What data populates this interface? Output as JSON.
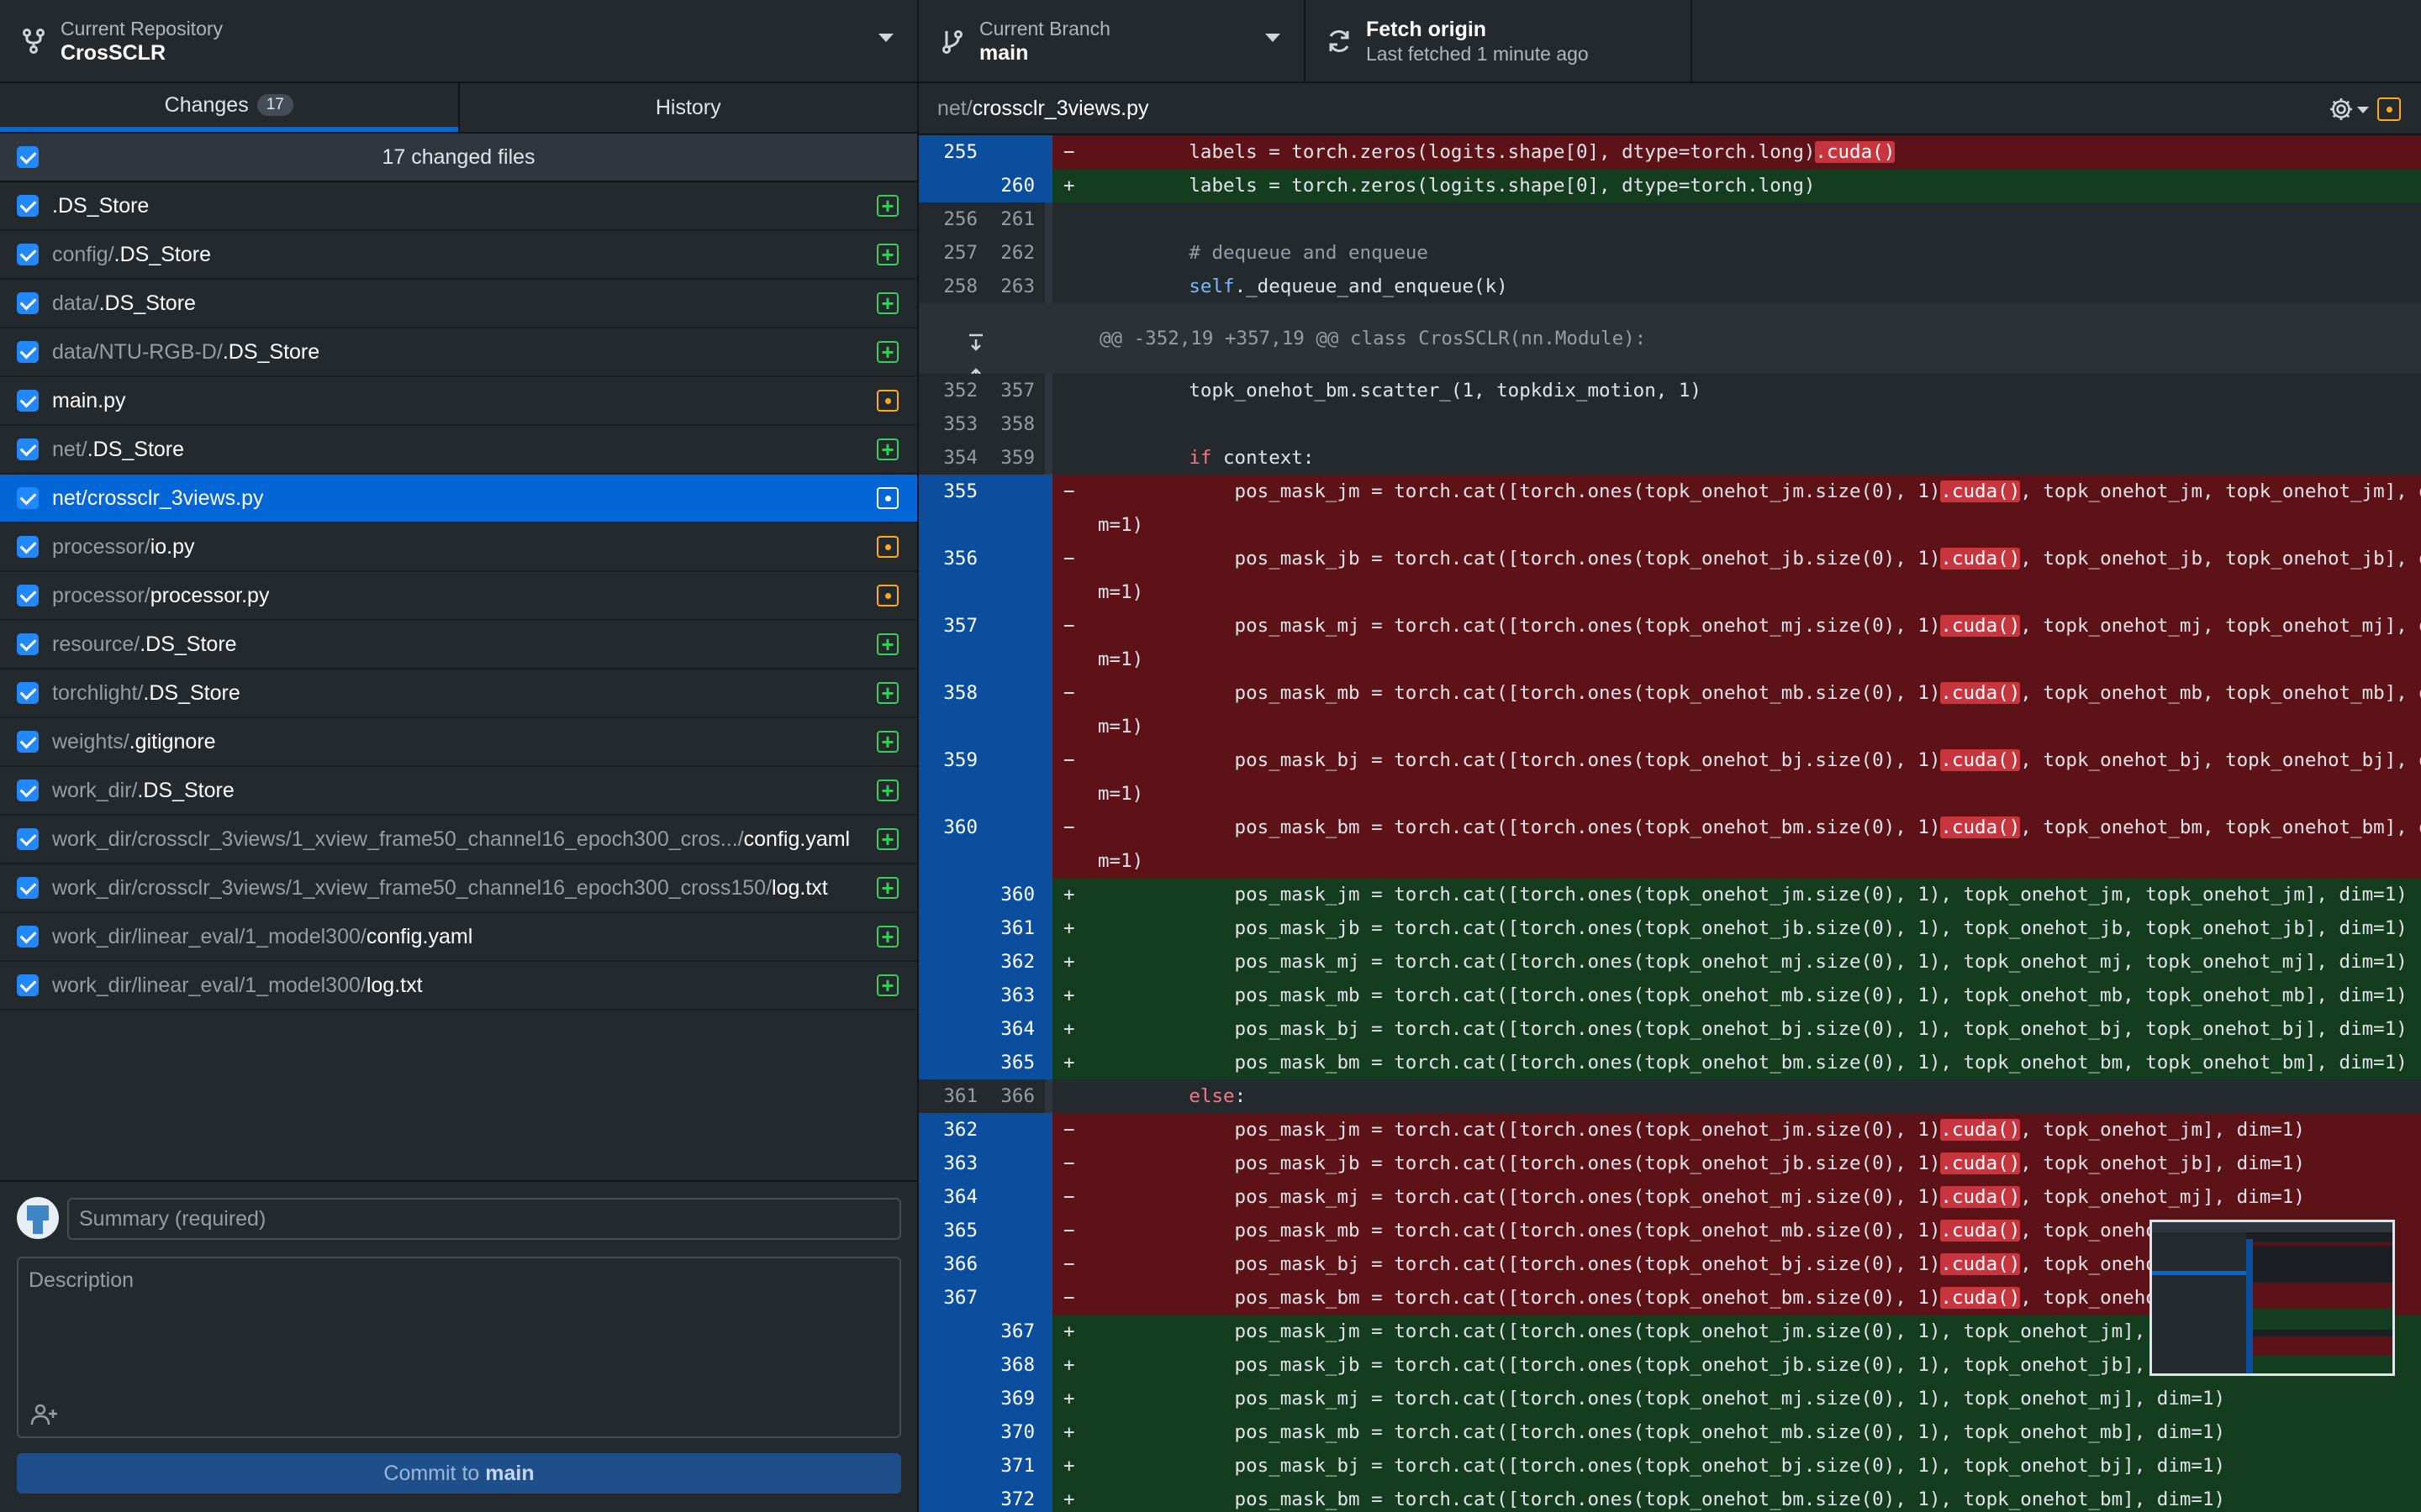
{
  "toolbar": {
    "repo_label": "Current Repository",
    "repo_name": "CrosSCLR",
    "branch_label": "Current Branch",
    "branch_name": "main",
    "fetch_title": "Fetch origin",
    "fetch_sub": "Last fetched 1 minute ago"
  },
  "tabs": {
    "changes_label": "Changes",
    "changes_count": "17",
    "history_label": "History"
  },
  "files_header": "17 changed files",
  "files": [
    {
      "dir": "",
      "name": ".DS_Store",
      "status": "new"
    },
    {
      "dir": "config/",
      "name": ".DS_Store",
      "status": "new"
    },
    {
      "dir": "data/",
      "name": ".DS_Store",
      "status": "new"
    },
    {
      "dir": "data/NTU-RGB-D/",
      "name": ".DS_Store",
      "status": "new"
    },
    {
      "dir": "",
      "name": "main.py",
      "status": "modified"
    },
    {
      "dir": "net/",
      "name": ".DS_Store",
      "status": "new"
    },
    {
      "dir": "net/",
      "name": "crossclr_3views.py",
      "status": "modified",
      "selected": true
    },
    {
      "dir": "processor/",
      "name": "io.py",
      "status": "modified"
    },
    {
      "dir": "processor/",
      "name": "processor.py",
      "status": "modified"
    },
    {
      "dir": "resource/",
      "name": ".DS_Store",
      "status": "new"
    },
    {
      "dir": "torchlight/",
      "name": ".DS_Store",
      "status": "new"
    },
    {
      "dir": "weights/",
      "name": ".gitignore",
      "status": "new"
    },
    {
      "dir": "work_dir/",
      "name": ".DS_Store",
      "status": "new"
    },
    {
      "dir": "work_dir/crossclr_3views/1_xview_frame50_channel16_epoch300_cros.../",
      "name": "config.yaml",
      "status": "new"
    },
    {
      "dir": "work_dir/crossclr_3views/1_xview_frame50_channel16_epoch300_cross150/",
      "name": "log.txt",
      "status": "new"
    },
    {
      "dir": "work_dir/linear_eval/1_model300/",
      "name": "config.yaml",
      "status": "new"
    },
    {
      "dir": "work_dir/linear_eval/1_model300/",
      "name": "log.txt",
      "status": "new"
    }
  ],
  "commit": {
    "summary_placeholder": "Summary (required)",
    "description_placeholder": "Description",
    "button_prefix": "Commit to ",
    "button_branch": "main"
  },
  "diff": {
    "file_dir": "net/",
    "file_name": "crossclr_3views.py",
    "hunk_header": "@@ -352,19 +357,19 @@ class CrosSCLR(nn.Module):",
    "lines": [
      {
        "type": "del",
        "old": "255",
        "new": "",
        "segs": [
          [
            "",
            "        labels = torch.zeros(logits.shape[0], dtype=torch.long)"
          ],
          [
            "hl",
            ".cuda()"
          ]
        ]
      },
      {
        "type": "add",
        "old": "",
        "new": "260",
        "segs": [
          [
            "",
            "        labels = torch.zeros(logits.shape[0], dtype=torch.long)"
          ]
        ]
      },
      {
        "type": "ctx",
        "old": "256",
        "new": "261",
        "segs": [
          [
            "",
            ""
          ]
        ]
      },
      {
        "type": "ctx",
        "old": "257",
        "new": "262",
        "segs": [
          [
            "cm",
            "        # dequeue and enqueue"
          ]
        ]
      },
      {
        "type": "ctx",
        "old": "258",
        "new": "263",
        "segs": [
          [
            "sf",
            "        self"
          ],
          [
            "",
            "._dequeue_and_enqueue(k)"
          ]
        ]
      },
      {
        "type": "hunk"
      },
      {
        "type": "ctx",
        "old": "352",
        "new": "357",
        "segs": [
          [
            "",
            "        topk_onehot_bm.scatter_(1, topkdix_motion, 1)"
          ]
        ]
      },
      {
        "type": "ctx",
        "old": "353",
        "new": "358",
        "segs": [
          [
            "",
            ""
          ]
        ]
      },
      {
        "type": "ctx",
        "old": "354",
        "new": "359",
        "segs": [
          [
            "kw",
            "        if"
          ],
          [
            "",
            " context:"
          ]
        ]
      },
      {
        "type": "del",
        "old": "355",
        "new": "",
        "segs": [
          [
            "",
            "            pos_mask_jm = torch.cat([torch.ones(topk_onehot_jm.size(0), 1)"
          ],
          [
            "hl",
            ".cuda()"
          ],
          [
            "",
            ", topk_onehot_jm, topk_onehot_jm], di"
          ]
        ]
      },
      {
        "type": "delw",
        "segs": [
          [
            "",
            "m=1)"
          ]
        ]
      },
      {
        "type": "del",
        "old": "356",
        "new": "",
        "segs": [
          [
            "",
            "            pos_mask_jb = torch.cat([torch.ones(topk_onehot_jb.size(0), 1)"
          ],
          [
            "hl",
            ".cuda()"
          ],
          [
            "",
            ", topk_onehot_jb, topk_onehot_jb], di"
          ]
        ]
      },
      {
        "type": "delw",
        "segs": [
          [
            "",
            "m=1)"
          ]
        ]
      },
      {
        "type": "del",
        "old": "357",
        "new": "",
        "segs": [
          [
            "",
            "            pos_mask_mj = torch.cat([torch.ones(topk_onehot_mj.size(0), 1)"
          ],
          [
            "hl",
            ".cuda()"
          ],
          [
            "",
            ", topk_onehot_mj, topk_onehot_mj], di"
          ]
        ]
      },
      {
        "type": "delw",
        "segs": [
          [
            "",
            "m=1)"
          ]
        ]
      },
      {
        "type": "del",
        "old": "358",
        "new": "",
        "segs": [
          [
            "",
            "            pos_mask_mb = torch.cat([torch.ones(topk_onehot_mb.size(0), 1)"
          ],
          [
            "hl",
            ".cuda()"
          ],
          [
            "",
            ", topk_onehot_mb, topk_onehot_mb], di"
          ]
        ]
      },
      {
        "type": "delw",
        "segs": [
          [
            "",
            "m=1)"
          ]
        ]
      },
      {
        "type": "del",
        "old": "359",
        "new": "",
        "segs": [
          [
            "",
            "            pos_mask_bj = torch.cat([torch.ones(topk_onehot_bj.size(0), 1)"
          ],
          [
            "hl",
            ".cuda()"
          ],
          [
            "",
            ", topk_onehot_bj, topk_onehot_bj], di"
          ]
        ]
      },
      {
        "type": "delw",
        "segs": [
          [
            "",
            "m=1)"
          ]
        ]
      },
      {
        "type": "del",
        "old": "360",
        "new": "",
        "segs": [
          [
            "",
            "            pos_mask_bm = torch.cat([torch.ones(topk_onehot_bm.size(0), 1)"
          ],
          [
            "hl",
            ".cuda()"
          ],
          [
            "",
            ", topk_onehot_bm, topk_onehot_bm], di"
          ]
        ]
      },
      {
        "type": "delw",
        "segs": [
          [
            "",
            "m=1)"
          ]
        ]
      },
      {
        "type": "add",
        "old": "",
        "new": "360",
        "segs": [
          [
            "",
            "            pos_mask_jm = torch.cat([torch.ones(topk_onehot_jm.size(0), 1), topk_onehot_jm, topk_onehot_jm], dim=1)"
          ]
        ]
      },
      {
        "type": "add",
        "old": "",
        "new": "361",
        "segs": [
          [
            "",
            "            pos_mask_jb = torch.cat([torch.ones(topk_onehot_jb.size(0), 1), topk_onehot_jb, topk_onehot_jb], dim=1)"
          ]
        ]
      },
      {
        "type": "add",
        "old": "",
        "new": "362",
        "segs": [
          [
            "",
            "            pos_mask_mj = torch.cat([torch.ones(topk_onehot_mj.size(0), 1), topk_onehot_mj, topk_onehot_mj], dim=1)"
          ]
        ]
      },
      {
        "type": "add",
        "old": "",
        "new": "363",
        "segs": [
          [
            "",
            "            pos_mask_mb = torch.cat([torch.ones(topk_onehot_mb.size(0), 1), topk_onehot_mb, topk_onehot_mb], dim=1)"
          ]
        ]
      },
      {
        "type": "add",
        "old": "",
        "new": "364",
        "segs": [
          [
            "",
            "            pos_mask_bj = torch.cat([torch.ones(topk_onehot_bj.size(0), 1), topk_onehot_bj, topk_onehot_bj], dim=1)"
          ]
        ]
      },
      {
        "type": "add",
        "old": "",
        "new": "365",
        "segs": [
          [
            "",
            "            pos_mask_bm = torch.cat([torch.ones(topk_onehot_bm.size(0), 1), topk_onehot_bm, topk_onehot_bm], dim=1)"
          ]
        ]
      },
      {
        "type": "ctx",
        "old": "361",
        "new": "366",
        "segs": [
          [
            "kw",
            "        else"
          ],
          [
            "",
            ":"
          ]
        ]
      },
      {
        "type": "del",
        "old": "362",
        "new": "",
        "segs": [
          [
            "",
            "            pos_mask_jm = torch.cat([torch.ones(topk_onehot_jm.size(0), 1)"
          ],
          [
            "hl",
            ".cuda()"
          ],
          [
            "",
            ", topk_onehot_jm], dim=1)"
          ]
        ]
      },
      {
        "type": "del",
        "old": "363",
        "new": "",
        "segs": [
          [
            "",
            "            pos_mask_jb = torch.cat([torch.ones(topk_onehot_jb.size(0), 1)"
          ],
          [
            "hl",
            ".cuda()"
          ],
          [
            "",
            ", topk_onehot_jb], dim=1)"
          ]
        ]
      },
      {
        "type": "del",
        "old": "364",
        "new": "",
        "segs": [
          [
            "",
            "            pos_mask_mj = torch.cat([torch.ones(topk_onehot_mj.size(0), 1)"
          ],
          [
            "hl",
            ".cuda()"
          ],
          [
            "",
            ", topk_onehot_mj], dim=1)"
          ]
        ]
      },
      {
        "type": "del",
        "old": "365",
        "new": "",
        "segs": [
          [
            "",
            "            pos_mask_mb = torch.cat([torch.ones(topk_onehot_mb.size(0), 1)"
          ],
          [
            "hl",
            ".cuda()"
          ],
          [
            "",
            ", topk_onehot_mb], dim=1)"
          ]
        ]
      },
      {
        "type": "del",
        "old": "366",
        "new": "",
        "segs": [
          [
            "",
            "            pos_mask_bj = torch.cat([torch.ones(topk_onehot_bj.size(0), 1)"
          ],
          [
            "hl",
            ".cuda()"
          ],
          [
            "",
            ", topk_onehot_bj], dim=1)"
          ]
        ]
      },
      {
        "type": "del",
        "old": "367",
        "new": "",
        "segs": [
          [
            "",
            "            pos_mask_bm = torch.cat([torch.ones(topk_onehot_bm.size(0), 1)"
          ],
          [
            "hl",
            ".cuda()"
          ],
          [
            "",
            ", topk_onehot_bm], dim=1)"
          ]
        ]
      },
      {
        "type": "add",
        "old": "",
        "new": "367",
        "segs": [
          [
            "",
            "            pos_mask_jm = torch.cat([torch.ones(topk_onehot_jm.size(0), 1), topk_onehot_jm], dim=1)"
          ]
        ]
      },
      {
        "type": "add",
        "old": "",
        "new": "368",
        "segs": [
          [
            "",
            "            pos_mask_jb = torch.cat([torch.ones(topk_onehot_jb.size(0), 1), topk_onehot_jb], dim=1)"
          ]
        ]
      },
      {
        "type": "add",
        "old": "",
        "new": "369",
        "segs": [
          [
            "",
            "            pos_mask_mj = torch.cat([torch.ones(topk_onehot_mj.size(0), 1), topk_onehot_mj], dim=1)"
          ]
        ]
      },
      {
        "type": "add",
        "old": "",
        "new": "370",
        "segs": [
          [
            "",
            "            pos_mask_mb = torch.cat([torch.ones(topk_onehot_mb.size(0), 1), topk_onehot_mb], dim=1)"
          ]
        ]
      },
      {
        "type": "add",
        "old": "",
        "new": "371",
        "segs": [
          [
            "",
            "            pos_mask_bj = torch.cat([torch.ones(topk_onehot_bj.size(0), 1), topk_onehot_bj], dim=1)"
          ]
        ]
      },
      {
        "type": "add",
        "old": "",
        "new": "372",
        "segs": [
          [
            "",
            "            pos_mask_bm = torch.cat([torch.ones(topk_onehot_bm.size(0), 1), topk_onehot_bm], dim=1)"
          ]
        ]
      }
    ]
  },
  "colors": {
    "accent": "#0366d6",
    "added_bg": "#143d1f",
    "removed_bg": "#5d1218",
    "new_status": "#34d058",
    "modified_status": "#ffab19"
  }
}
